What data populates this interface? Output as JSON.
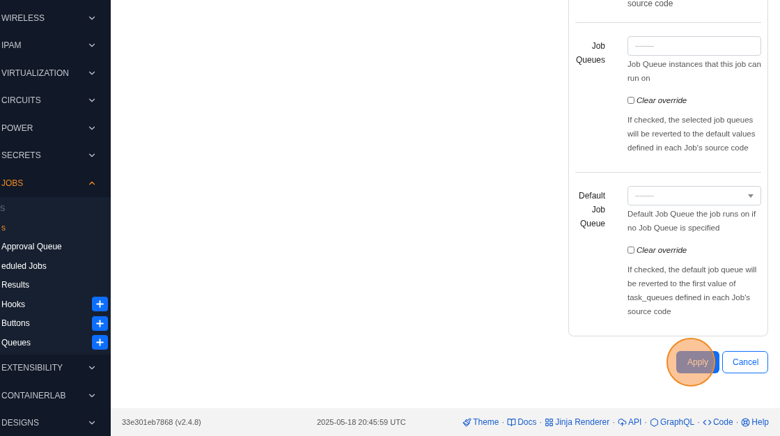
{
  "sidebar": {
    "items": [
      {
        "label": "WIRELESS",
        "expanded": false,
        "active": false
      },
      {
        "label": "IPAM",
        "expanded": false,
        "active": false
      },
      {
        "label": "VIRTUALIZATION",
        "expanded": false,
        "active": false
      },
      {
        "label": "CIRCUITS",
        "expanded": false,
        "active": false
      },
      {
        "label": "POWER",
        "expanded": false,
        "active": false
      },
      {
        "label": "SECRETS",
        "expanded": false,
        "active": false
      },
      {
        "label": "JOBS",
        "expanded": true,
        "active": true,
        "children": [
          {
            "kind": "heading",
            "label": "S"
          },
          {
            "kind": "link",
            "label": "s",
            "selected": true,
            "add_button": false
          },
          {
            "kind": "link",
            "label": "Approval Queue",
            "selected": false,
            "add_button": false
          },
          {
            "kind": "link",
            "label": "eduled Jobs",
            "selected": false,
            "add_button": false
          },
          {
            "kind": "link",
            "label": "Results",
            "selected": false,
            "add_button": false
          },
          {
            "kind": "link",
            "label": "Hooks",
            "selected": false,
            "add_button": true
          },
          {
            "kind": "link",
            "label": "Buttons",
            "selected": false,
            "add_button": true
          },
          {
            "kind": "link",
            "label": "Queues",
            "selected": false,
            "add_button": true
          }
        ]
      },
      {
        "label": "EXTENSIBILITY",
        "expanded": false,
        "active": false
      },
      {
        "label": "CONTAINERLAB",
        "expanded": false,
        "active": false
      },
      {
        "label": "DESIGNS",
        "expanded": false,
        "active": false
      }
    ]
  },
  "form": {
    "top_fragment": "source code",
    "fields": [
      {
        "label": "Job Queues",
        "kind": "multiselect",
        "placeholder": "---------",
        "help": "Job Queue instances that this job can run on",
        "clear_override": {
          "label": "Clear override",
          "checked": false
        },
        "override_help": "If checked, the selected job queues will be reverted to the default values defined in each Job's source code"
      },
      {
        "label": "Default Job Queue",
        "kind": "select",
        "placeholder": "---------",
        "help": "Default Job Queue the job runs on if no Job Queue is specified",
        "clear_override": {
          "label": "Clear override",
          "checked": false
        },
        "override_help": "If checked, the default job queue will be reverted to the first value of task_queues defined in each Job's source code"
      }
    ]
  },
  "buttons": [
    {
      "label": "Apply",
      "kind": "primary",
      "highlighted": true
    },
    {
      "label": "Cancel",
      "kind": "secondary",
      "highlighted": false
    }
  ],
  "footer": {
    "version": "33e301eb7868 (v2.4.8)",
    "timestamp": "2025-05-18 20:45:59 UTC",
    "links": [
      {
        "label": "Theme"
      },
      {
        "label": "Docs"
      },
      {
        "label": "Jinja Renderer"
      },
      {
        "label": "API"
      },
      {
        "label": "GraphQL"
      },
      {
        "label": "Code"
      },
      {
        "label": "Help"
      }
    ],
    "separator": "·"
  }
}
